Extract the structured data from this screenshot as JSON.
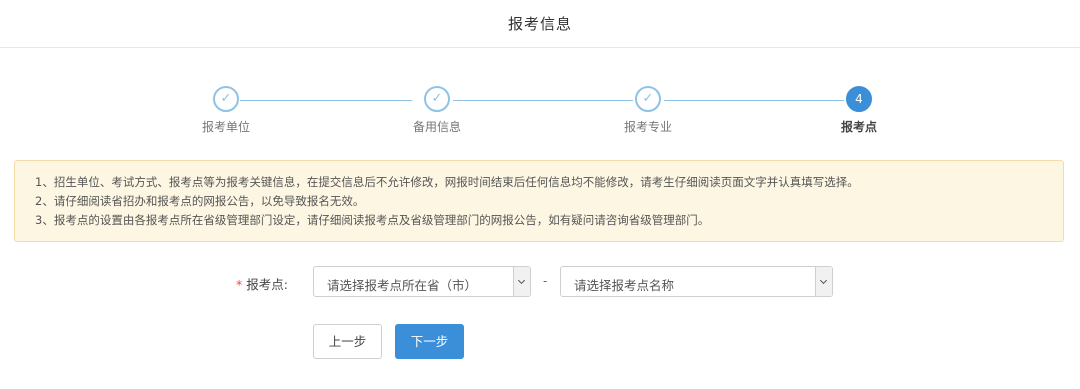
{
  "header": {
    "title": "报考信息"
  },
  "steps": [
    {
      "label": "报考单位",
      "icon": "check-icon",
      "mark": "✓",
      "done": true
    },
    {
      "label": "备用信息",
      "icon": "check-icon",
      "mark": "✓",
      "done": true
    },
    {
      "label": "报考专业",
      "icon": "check-icon",
      "mark": "✓",
      "done": true
    },
    {
      "label": "报考点",
      "icon": "step-number",
      "mark": "4",
      "done": false,
      "active": true
    }
  ],
  "notice": {
    "lines": [
      "1、招生单位、考试方式、报考点等为报考关键信息，在提交信息后不允许修改，网报时间结束后任何信息均不能修改，请考生仔细阅读页面文字并认真填写选择。",
      "2、请仔细阅读省招办和报考点的网报公告，以免导致报名无效。",
      "3、报考点的设置由各报考点所在省级管理部门设定，请仔细阅读报考点及省级管理部门的网报公告，如有疑问请咨询省级管理部门。"
    ]
  },
  "form": {
    "required_mark": "*",
    "label": "报考点:",
    "province_select": {
      "value": "请选择报考点所在省（市）"
    },
    "separator": "-",
    "site_select": {
      "value": "请选择报考点名称"
    }
  },
  "buttons": {
    "prev": "上一步",
    "next": "下一步"
  },
  "colors": {
    "primary": "#3b8fd8",
    "step_done": "#8ec3e6",
    "notice_bg": "#fdf6e3",
    "notice_border": "#f6dca6",
    "required": "#e74c3c"
  }
}
